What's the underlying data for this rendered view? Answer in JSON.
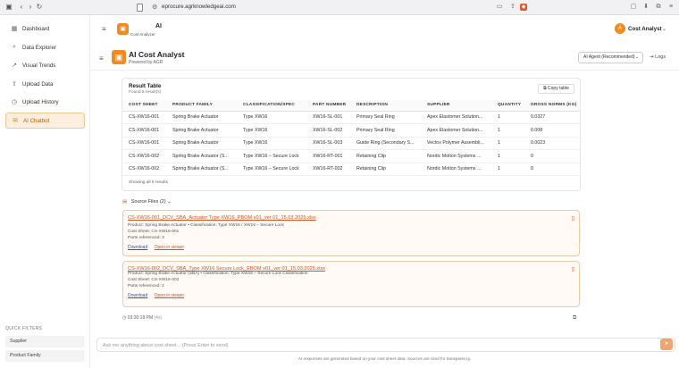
{
  "browser": {
    "url": "eprocure.agrknowledgeai.com"
  },
  "sidebar": {
    "items": [
      {
        "label": "Dashboard",
        "icon": "grid-icon"
      },
      {
        "label": "Data Explorer",
        "icon": "search-icon"
      },
      {
        "label": "Visual Trends",
        "icon": "trend-icon"
      },
      {
        "label": "Upload Data",
        "icon": "upload-icon"
      },
      {
        "label": "Upload History",
        "icon": "history-icon"
      },
      {
        "label": "AI Chatbot",
        "icon": "chat-icon",
        "active": true
      }
    ],
    "quick_filters_title": "QUICK FILTERS",
    "quick_filters": [
      "Supplier",
      "Product Family"
    ]
  },
  "top_header": {
    "title_fragment": "AI",
    "subtitle": "Cost Analyzer",
    "user_initial": "A",
    "user_name": "Cost Analyst"
  },
  "app_header": {
    "title": "AI Cost Analyst",
    "subtitle": "Powered by AGR",
    "agent_select": "AI Agent (Recommended)",
    "logs_label": "Logs"
  },
  "result": {
    "title": "Result Table",
    "subtitle": "Found 5 result(s)",
    "copy_label": "Copy table",
    "columns": [
      "COST SHEET",
      "PRODUCT FAMILY",
      "CLASSIFICATION/SPEC",
      "PART NUMBER",
      "DESCRIPTION",
      "SUPPLIER",
      "QUANTITY",
      "GROSS NORMS (KG)"
    ],
    "rows": [
      [
        "CS-XW16-001",
        "Spring Brake Actuator",
        "Type XW16",
        "XW16-SL-001",
        "Primary Seal Ring",
        "Apex Elastomer Solution...",
        "1",
        "0.0327"
      ],
      [
        "CS-XW16-001",
        "Spring Brake Actuator",
        "Type XW16",
        "XW16-SL-002",
        "Primary Seal Ring",
        "Apex Elastomer Solution...",
        "1",
        "0.008"
      ],
      [
        "CS-XW16-001",
        "Spring Brake Actuator",
        "Type XW16",
        "XW16-SL-003",
        "Guide Ring (Secondary S...",
        "Vectox Polymer Assembli...",
        "1",
        "0.0023"
      ],
      [
        "CS-XW16-002",
        "Spring Brake Actuator (S...",
        "Type XW16 – Secure Lock",
        "XW16-RT-001",
        "Retaining Clip",
        "Nordic Motion Systems ...",
        "1",
        "0"
      ],
      [
        "CS-XW16-002",
        "Spring Brake Actuator (S...",
        "Type XW16 – Secure Lock",
        "XW16-RT-002",
        "Retaining Clip",
        "Nordic Motion Systems ...",
        "1",
        "0"
      ]
    ],
    "footer": "Showing all 5 results"
  },
  "sources": {
    "header": "Source Files (2)",
    "files": [
      {
        "name": "CS-XW16-001_DCV_SBA_Actuator Type XW16_PBOM v01_ver 01_15.03.2025.xlsx",
        "product_line": "Product: Spring Brake Actuator • Classification: Type XW16 / XW16 – Secure Lock",
        "cost_sheet": "Cost Sheet: CS-XW16-001",
        "parts": "Parts referenced: 3",
        "download": "Download",
        "open": "Open in viewer"
      },
      {
        "name": "CS-XW16-002_DCV_SBA_Type XW16 Secure Lock_EBOM v01_ver 01_15.03.2025.xlsx",
        "product_line": "Product: Spring Brake Actuator (SBA) • Classification: Type XW16 – Secure Lock Classification",
        "cost_sheet": "Cost Sheet: CS-XW16-002",
        "parts": "Parts referenced: 2",
        "download": "Download",
        "open": "Open in viewer"
      }
    ]
  },
  "timestamp": "03:30:18 PM",
  "timestamp_note": "(4s)",
  "input": {
    "placeholder": "Ask me anything about cost sheet... (Press Enter to send)",
    "value": ""
  },
  "disclaimer": "AI responses are generated based on your cost sheet data. Sources are cited for transparency.",
  "colors": {
    "accent": "#f08a24",
    "active_bg": "#fcefdf",
    "link": "#d9531e"
  }
}
